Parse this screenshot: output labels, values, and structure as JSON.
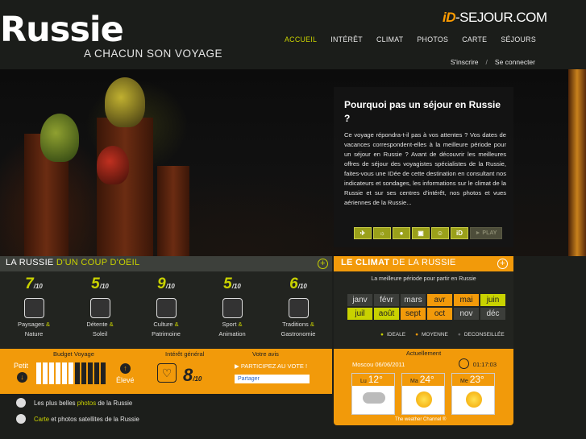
{
  "header": {
    "title": "Russie",
    "tagline": "A CHACUN SON VOYAGE",
    "brand_prefix": "iD",
    "brand_suffix": "-SEJOUR.COM",
    "nav": [
      "ACCUEIL",
      "INTÉRÊT",
      "CLIMAT",
      "PHOTOS",
      "CARTE",
      "SÉJOURS"
    ],
    "auth": {
      "signup": "S'inscrire",
      "sep": "/",
      "login": "Se connecter"
    }
  },
  "hero": {
    "title": "Pourquoi pas un séjour en Russie ?",
    "text": "Ce voyage répondra-t-il pas à vos attentes ? Vos dates de vacances correspondent-elles à la meilleure période pour un séjour en Russie ? Avant de découvrir les meilleures offres de séjour des voyagistes spécialistes de la Russie, faites-vous une IDée de cette destination en consultant nos indicateurs et sondages, les informations sur le climat de la Russie et sur ses centres d'intérêt, nos photos et vues aériennes de la Russie...",
    "play": "► PLAY"
  },
  "overview": {
    "title_a": "LA RUSSIE ",
    "title_b": "D'UN COUP D'OEIL",
    "denom": "/10",
    "categories": [
      {
        "score": "7",
        "l1": "Paysages",
        "amp": " &",
        "l2": "Nature"
      },
      {
        "score": "5",
        "l1": "Détente",
        "amp": " &",
        "l2": "Soleil"
      },
      {
        "score": "9",
        "l1": "Culture",
        "amp": " &",
        "l2": "Patrimoine"
      },
      {
        "score": "5",
        "l1": "Sport",
        "amp": " &",
        "l2": "Animation"
      },
      {
        "score": "6",
        "l1": "Traditions",
        "amp": " &",
        "l2": "Gastronomie"
      }
    ]
  },
  "budget": {
    "label": "Budget Voyage",
    "low": "Petit",
    "high": "Élevé",
    "level": 0.55,
    "interest_label": "Intérêt général",
    "interest_score": "8",
    "interest_denom": "/10",
    "vote_label": "Votre avis",
    "vote_cta": "▶ PARTICIPEZ AU VOTE !",
    "share": "Partager"
  },
  "links": {
    "photos_a": "Les plus belles ",
    "photos_b": "photos",
    "photos_c": " de la Russie",
    "map_a": "Carte",
    "map_b": " et photos satellites de la Russie"
  },
  "climat": {
    "title_a": "LE CLIMAT",
    "title_b": " DE LA RUSSIE",
    "subtitle": "La meilleure période pour partir en Russie",
    "months": [
      {
        "name": "janv",
        "rating": "d"
      },
      {
        "name": "févr",
        "rating": "d"
      },
      {
        "name": "mars",
        "rating": "d"
      },
      {
        "name": "avr",
        "rating": "m"
      },
      {
        "name": "mai",
        "rating": "m"
      },
      {
        "name": "juin",
        "rating": "i"
      },
      {
        "name": "juil",
        "rating": "i"
      },
      {
        "name": "août",
        "rating": "i"
      },
      {
        "name": "sept",
        "rating": "m"
      },
      {
        "name": "oct",
        "rating": "m"
      },
      {
        "name": "nov",
        "rating": "d"
      },
      {
        "name": "déc",
        "rating": "d"
      }
    ],
    "legend": {
      "ideal": "IDEALE",
      "moyenne": "MOYENNE",
      "deconseillee": "DECONSEILLÉE"
    }
  },
  "weather": {
    "label": "Actuellement",
    "date": "Moscou 06/06/2011",
    "time": "01:17:03",
    "days": [
      {
        "day": "Lu",
        "temp": "12°",
        "icon": "cloud-icon"
      },
      {
        "day": "Ma",
        "temp": "24°",
        "icon": "sun-icon"
      },
      {
        "day": "Me",
        "temp": "23°",
        "icon": "sun-icon"
      }
    ],
    "footer": "The weather Channel ®"
  },
  "colors": {
    "accent": "#c9d200",
    "orange": "#f29a0a",
    "bg": "#1c1e1b"
  }
}
